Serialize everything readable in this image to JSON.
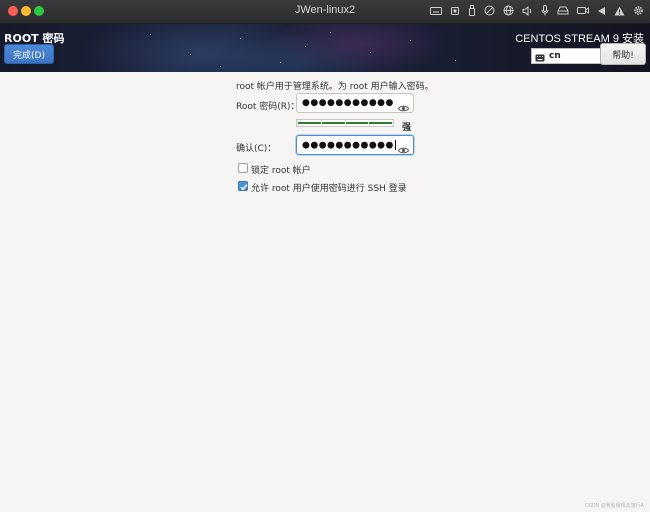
{
  "window": {
    "title": "JWen-linux2"
  },
  "toolbar_icons": [
    "keyboard-icon",
    "cpu-icon",
    "usb-icon",
    "disabled-icon",
    "network-icon",
    "speaker-icon",
    "microphone-icon",
    "drive-icon",
    "camera-icon",
    "play-icon",
    "warning-icon",
    "gear-icon"
  ],
  "header": {
    "page_title": "ROOT 密码",
    "done_label": "完成(D)",
    "product_title": "CENTOS STREAM 9 安装",
    "keyboard_layout": "cn",
    "help_label": "帮助!"
  },
  "form": {
    "intro": "root 帐户用于管理系统。为 root 用户输入密码。",
    "password_label": "Root 密码(R)：",
    "password_dots": "●●●●●●●●●●●",
    "strength_text": "强",
    "strength_segments": 4,
    "confirm_label": "确认(C)：",
    "confirm_dots": "●●●●●●●●●●●",
    "lock_root_label": "锁定 root 帐户",
    "lock_root_checked": false,
    "allow_ssh_label": "允许 root 用户使用密码进行 SSH 登录",
    "allow_ssh_checked": true
  },
  "watermark": "CSDN @我看晴晴去旅行A",
  "colors": {
    "accent": "#4a90d9",
    "strength": "#2f7d32",
    "done_button": "#3a74c4"
  }
}
